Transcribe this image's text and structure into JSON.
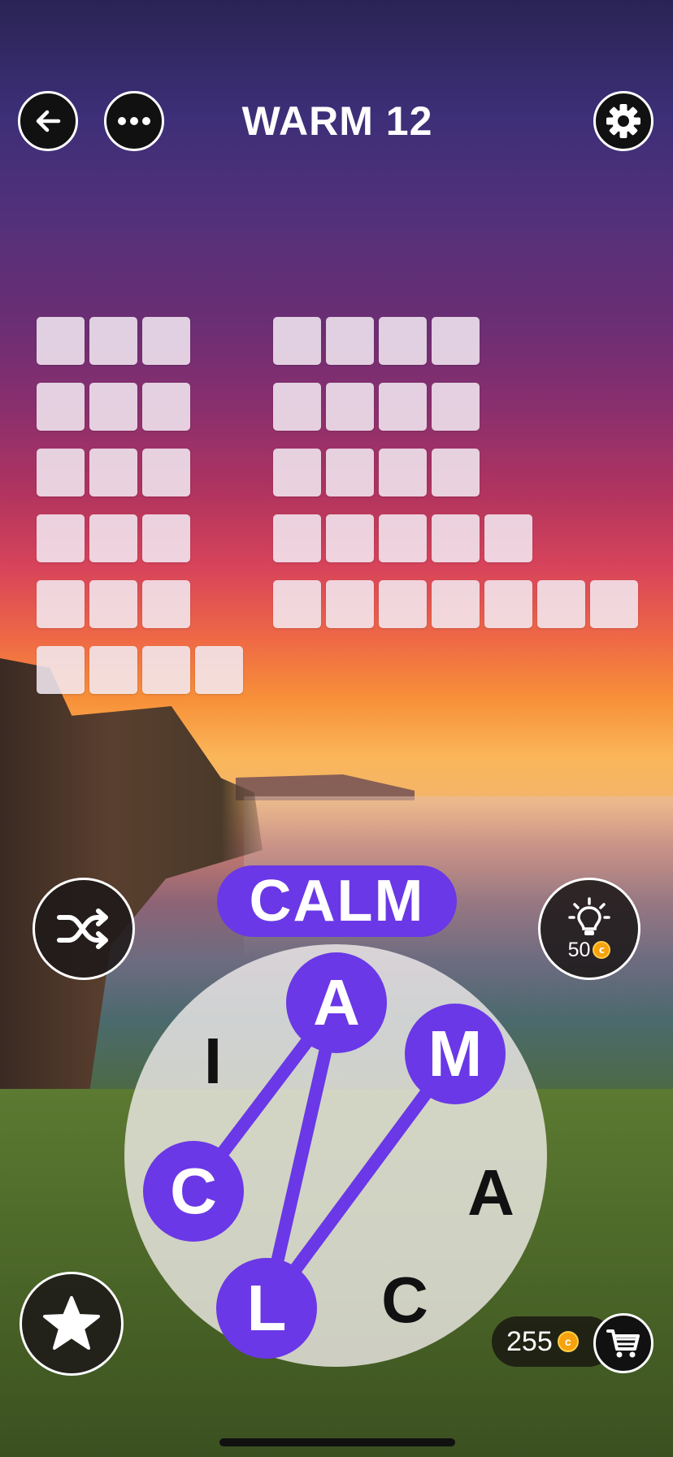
{
  "header": {
    "title": "WARM 12",
    "back_icon": "back-arrow-icon",
    "menu_icon": "more-dots-icon",
    "settings_icon": "gear-icon"
  },
  "puzzle": {
    "left_column_word_lengths": [
      3,
      3,
      3,
      3,
      3,
      4
    ],
    "right_column_word_lengths": [
      4,
      4,
      4,
      5,
      7
    ],
    "tile_color": "#f3ebf3"
  },
  "current_word": "CALM",
  "wheel": {
    "letters": [
      "A",
      "M",
      "A",
      "C",
      "L",
      "C",
      "I"
    ],
    "selected_sequence": [
      "C",
      "A",
      "L",
      "M"
    ],
    "accent_color": "#6a38e6"
  },
  "hint": {
    "cost": "50",
    "icon": "lightbulb-icon"
  },
  "shuffle": {
    "icon": "shuffle-icon"
  },
  "favorites": {
    "icon": "star-icon"
  },
  "wallet": {
    "coins": "255",
    "coin_icon": "coin-icon",
    "shop_icon": "cart-icon"
  }
}
